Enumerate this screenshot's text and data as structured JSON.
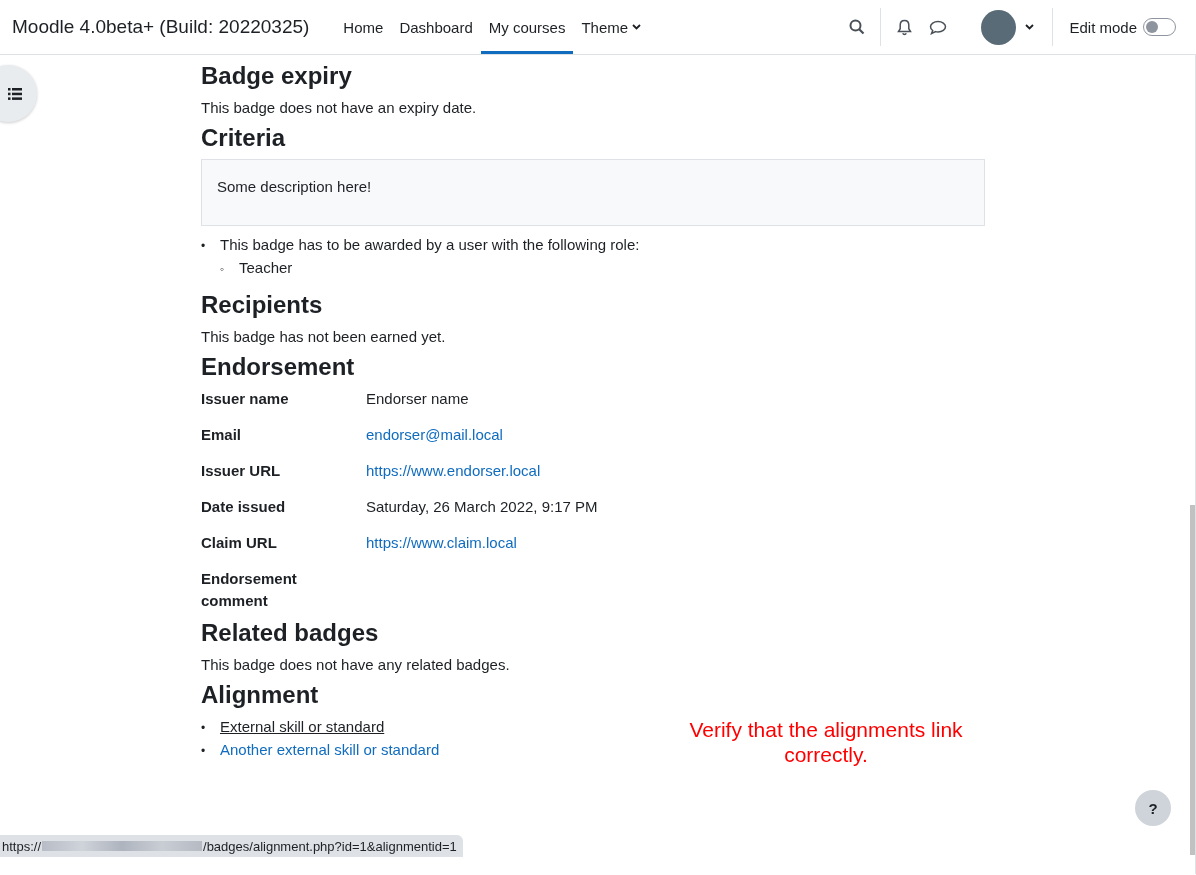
{
  "navbar": {
    "site_name": "Moodle 4.0beta+ (Build: 20220325)",
    "links": [
      {
        "label": "Home",
        "selected": false,
        "dropdown": false
      },
      {
        "label": "Dashboard",
        "selected": false,
        "dropdown": false
      },
      {
        "label": "My courses",
        "selected": true,
        "dropdown": false
      },
      {
        "label": "Theme",
        "selected": false,
        "dropdown": true
      }
    ],
    "edit_mode": {
      "label": "Edit mode",
      "on": false
    }
  },
  "sections": [
    {
      "kind": "text",
      "heading": "Badge expiry",
      "text": "This badge does not have an expiry date."
    },
    {
      "kind": "criteria",
      "heading": "Criteria",
      "description": "Some description here!",
      "items": [
        {
          "marker": "•",
          "text": "This badge has to be awarded by a user with the following role:",
          "children": [
            {
              "marker": "◦",
              "text": "Teacher"
            }
          ]
        }
      ]
    },
    {
      "kind": "text",
      "heading": "Recipients",
      "text": "This badge has not been earned yet."
    },
    {
      "kind": "fields",
      "heading": "Endorsement",
      "fields": [
        {
          "label": "Issuer name",
          "value": "Endorser name",
          "link": false
        },
        {
          "label": "Email",
          "value": "endorser@mail.local",
          "link": true
        },
        {
          "label": "Issuer URL",
          "value": "https://www.endorser.local",
          "link": true
        },
        {
          "label": "Date issued",
          "value": "Saturday, 26 March 2022, 9:17 PM",
          "link": false
        },
        {
          "label": "Claim URL",
          "value": "https://www.claim.local",
          "link": true
        },
        {
          "label": "Endorsement comment"
        }
      ]
    },
    {
      "kind": "text",
      "heading": "Related badges",
      "text": "This badge does not have any related badges."
    },
    {
      "kind": "links",
      "heading": "Alignment",
      "links": [
        {
          "marker": "•",
          "text": "External skill or standard",
          "hovered": true
        },
        {
          "marker": "•",
          "text": "Another external skill or standard",
          "hovered": false
        }
      ]
    }
  ],
  "annotation": {
    "text": "Verify that the alignments link correctly."
  },
  "help_button": {
    "label": "?"
  },
  "status_bar": {
    "prefix": "https://",
    "path": "/badges/alignment.php?id=1&alignmentid=1"
  }
}
